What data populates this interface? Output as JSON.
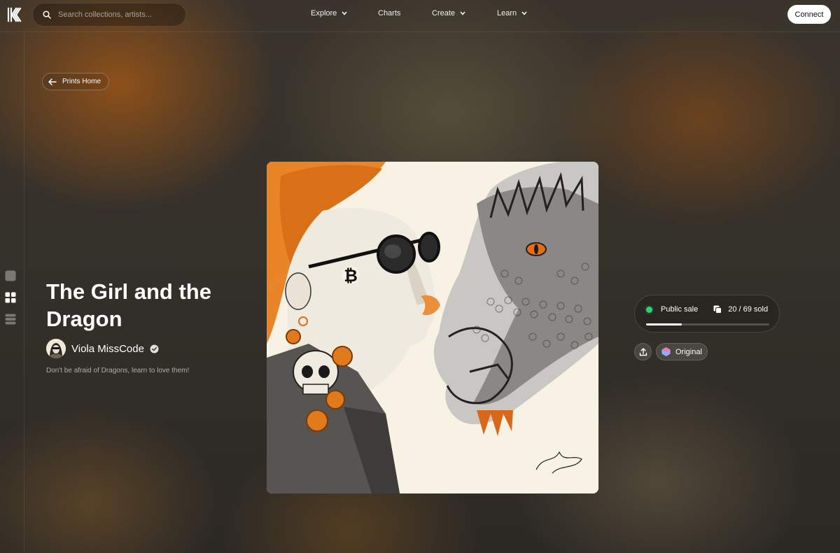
{
  "header": {
    "search": {
      "placeholder": "Search collections, artists..."
    },
    "nav": [
      {
        "label": "Explore",
        "has_dropdown": true
      },
      {
        "label": "Charts",
        "has_dropdown": false
      },
      {
        "label": "Create",
        "has_dropdown": true
      },
      {
        "label": "Learn",
        "has_dropdown": true
      }
    ],
    "connect_label": "Connect"
  },
  "sidebar": {
    "icons": [
      "square-icon",
      "grid-icon",
      "stack-icon"
    ]
  },
  "back": {
    "label": "Prints Home",
    "icon": "arrow-left-icon"
  },
  "artwork": {
    "title": "The Girl and the Dragon",
    "artist": "Viola MissCode",
    "artist_verified": true,
    "description": "Don't be afraid of Dragons, learn to love them!"
  },
  "sale": {
    "status": "Public sale",
    "status_color": "#2fcf74",
    "sold": 20,
    "total": 69,
    "sold_text": "20 / 69 sold",
    "progress_fraction": 0.29
  },
  "actions": {
    "share_icon": "upload-icon",
    "edition_label": "Original"
  },
  "colors": {
    "accent_orange": "#e07a1a",
    "connect_bg": "#ffffff"
  }
}
